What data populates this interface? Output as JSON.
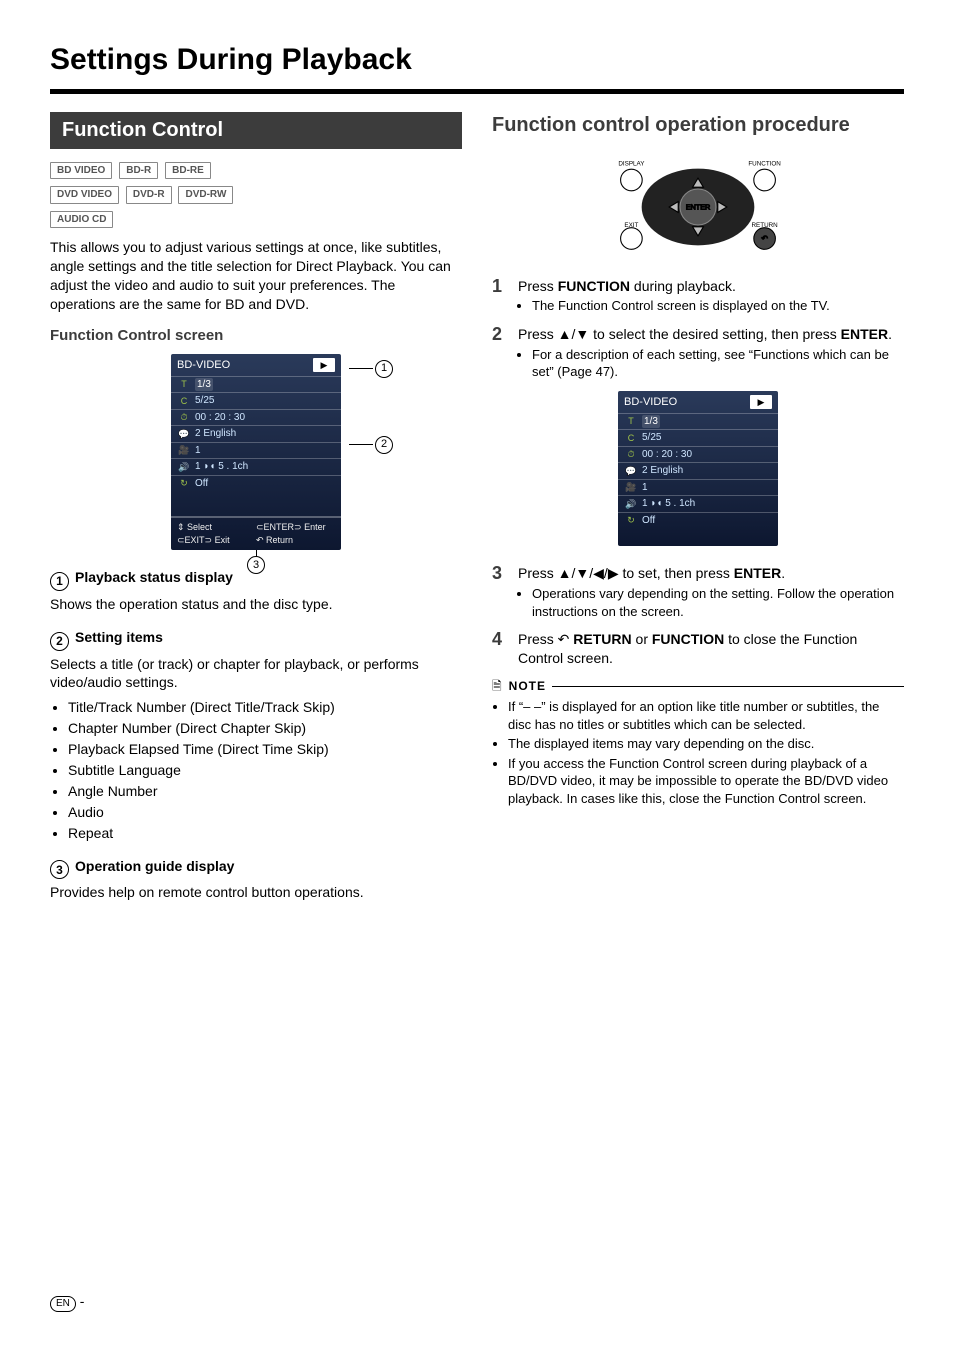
{
  "page_title": "Settings During Playback",
  "left": {
    "heading": "Function Control",
    "badge_rows": [
      [
        "BD VIDEO",
        "BD-R",
        "BD-RE"
      ],
      [
        "DVD VIDEO",
        "DVD-R",
        "DVD-RW"
      ],
      [
        "AUDIO CD"
      ]
    ],
    "intro": "This allows you to adjust various settings at once, like subtitles, angle settings and the title selection for Direct Playback. You can adjust the video and audio to suit your preferences. The operations are the same for BD and DVD.",
    "screen_title": "Function Control screen",
    "sec1_title": "Playback status display",
    "sec1_text": "Shows the operation status and the disc type.",
    "sec2_title": "Setting items",
    "sec2_text": "Selects a title (or track) or chapter for playback, or performs video/audio settings.",
    "sec2_bullets": [
      "Title/Track Number (Direct Title/Track Skip)",
      "Chapter Number (Direct Chapter Skip)",
      "Playback Elapsed Time (Direct Time Skip)",
      "Subtitle Language",
      "Angle Number",
      "Audio",
      "Repeat"
    ],
    "sec3_title": "Operation guide display",
    "sec3_text": "Provides help on remote control button operations."
  },
  "osd": {
    "disc": "BD-VIDEO",
    "rows": [
      {
        "icon": "T",
        "value": "1/3"
      },
      {
        "icon": "C",
        "value": "5/25"
      },
      {
        "icon": "⏱",
        "value": "00 : 20 : 30"
      },
      {
        "icon": "💬",
        "value": "2 English"
      },
      {
        "icon": "🎥",
        "value": "1"
      },
      {
        "icon": "🔊",
        "value": "1   ◗◖   5 . 1ch"
      },
      {
        "icon": "↻",
        "value": "Off"
      }
    ],
    "guide": {
      "select": "Select",
      "enter": "Enter",
      "exit": "Exit",
      "return": "Return"
    }
  },
  "right": {
    "heading": "Function control operation procedure",
    "remote_labels": {
      "display": "DISPLAY",
      "function": "FUNCTION",
      "exit": "EXIT",
      "return": "RETURN",
      "enter": "ENTER"
    },
    "steps": [
      {
        "n": "1",
        "main_pre": "Press ",
        "bold": "FUNCTION",
        "main_post": " during playback.",
        "subs": [
          "The Function Control screen is displayed on the TV."
        ]
      },
      {
        "n": "2",
        "main_pre": "Press ▲/▼ to select the desired setting, then press ",
        "bold": "ENTER",
        "main_post": ".",
        "subs": [
          "For a description of each setting, see “Functions which can be set” (Page 47)."
        ]
      },
      {
        "n": "3",
        "main_pre": "Press ▲/▼/◀/▶ to set, then press ",
        "bold": "ENTER",
        "main_post": ".",
        "subs": [
          "Operations vary depending on the setting. Follow the operation instructions on the screen."
        ]
      },
      {
        "n": "4",
        "main_pre": "Press ↶ ",
        "bold": "RETURN",
        "main_mid": " or ",
        "bold2": "FUNCTION",
        "main_post": " to close the Function Control screen.",
        "subs": []
      }
    ],
    "note_label": "NOTE",
    "notes": [
      "If “– –” is displayed for an option like title number or subtitles, the disc has no titles or subtitles which can be selected.",
      "The displayed items may vary depending on the disc.",
      "If you access the Function Control screen during playback of a BD/DVD video, it may be impossible to operate the BD/DVD video playback. In cases like this, close the Function Control screen."
    ]
  },
  "footer": {
    "lang": "EN"
  },
  "chart_data": {
    "type": "table",
    "title": "Function Control OSD values",
    "rows": [
      [
        "Disc type",
        "BD-VIDEO"
      ],
      [
        "Title/Track",
        "1/3"
      ],
      [
        "Chapter",
        "5/25"
      ],
      [
        "Elapsed time",
        "00:20:30"
      ],
      [
        "Subtitle",
        "2 English"
      ],
      [
        "Angle",
        "1"
      ],
      [
        "Audio",
        "1  5.1ch"
      ],
      [
        "Repeat",
        "Off"
      ]
    ]
  }
}
